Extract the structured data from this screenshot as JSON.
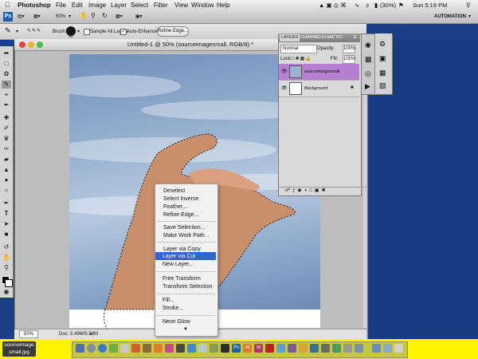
{
  "menubar": {
    "app_name": "Photoshop",
    "items": [
      "File",
      "Edit",
      "Image",
      "Layer",
      "Select",
      "Filter",
      "View",
      "Window",
      "Help"
    ],
    "battery": "(30%)",
    "clock": "Sun 5:19 PM"
  },
  "appbar": {
    "zoom": "50%",
    "workspace": "AUTOMATION"
  },
  "options": {
    "brush_label": "Brush:",
    "brush_size": "90",
    "sample_all_layers": "Sample All Layers",
    "auto_enhance": "Auto-Enhance",
    "refine_edge": "Refine Edge..."
  },
  "document": {
    "title": "Untitled-1 @ 50% (sourceimagesmall, RGB/8) *",
    "zoom": "50%",
    "doc_info": "Doc: 5.49M/5.58M"
  },
  "layers_panel": {
    "tabs": [
      "LAYERS",
      "CHANN",
      "ADJUS",
      "ACTIO"
    ],
    "blend_mode": "Normal",
    "opacity_label": "Opacity:",
    "opacity_value": "100%",
    "lock_label": "Lock:",
    "fill_label": "Fill:",
    "fill_value": "100%",
    "layers": [
      {
        "name": "sourceimagesmall"
      },
      {
        "name": "Background"
      }
    ]
  },
  "context_menu": {
    "items": [
      "Deselect",
      "Select Inverse",
      "Feather...",
      "Refine Edge...",
      "Save Selection...",
      "Make Work Path...",
      "Layer via Copy",
      "Layer via Cut",
      "New Layer...",
      "Free Transform",
      "Transform Selection",
      "Fill...",
      "Stroke...",
      "Neon Glow"
    ],
    "highlighted": "Layer via Cut"
  },
  "dock": {
    "file_label_line1": "sourceimage",
    "file_label_line2": "small.jpg"
  },
  "colors": {
    "menu_highlight": "#2f64d4",
    "layer_selected": "#b67fd0",
    "desktop": "#1b3f86",
    "dock": "#fff400"
  }
}
